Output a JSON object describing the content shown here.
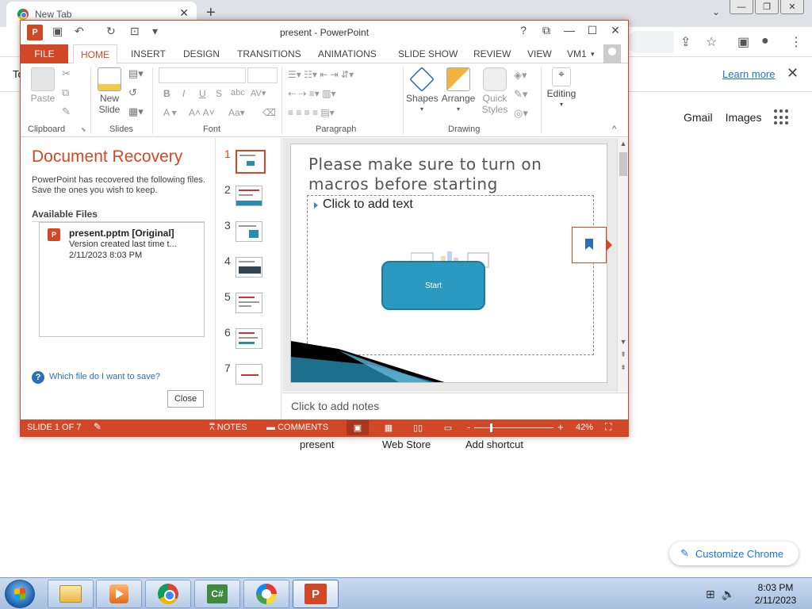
{
  "chrome": {
    "tab_title": "New Tab",
    "tab_close": "✕",
    "new_tab": "+",
    "tab_menu": "⌄",
    "win_minimize": "—",
    "win_restore": "❐",
    "win_close": "✕",
    "infobar_left": "To",
    "learn_more": "Learn more",
    "infobar_close": "✕",
    "gmail": "Gmail",
    "images": "Images",
    "shortcuts": [
      "present",
      "Web Store",
      "Add shortcut"
    ],
    "customize": "Customize Chrome",
    "customize_icon": "✎"
  },
  "powerpoint": {
    "logo": "P",
    "title": "present - PowerPoint",
    "help": "?",
    "ribbon_display": "⧉",
    "minimize": "—",
    "maximize": "☐",
    "close": "✕",
    "qat_save": "💾",
    "qat_undo": "↶",
    "qat_redo": "↻",
    "qat_custom": "▾",
    "tabs": {
      "file": "FILE",
      "home": "HOME",
      "insert": "INSERT",
      "design": "DESIGN",
      "transitions": "TRANSITIONS",
      "animations": "ANIMATIONS",
      "slideshow": "SLIDE SHOW",
      "review": "REVIEW",
      "view": "VIEW",
      "user": "VM1"
    },
    "ribbon": {
      "paste": "Paste",
      "new_slide_1": "New",
      "new_slide_2": "Slide",
      "shapes": "Shapes",
      "arrange": "Arrange",
      "quick_styles_1": "Quick",
      "quick_styles_2": "Styles",
      "editing": "Editing",
      "bold": "B",
      "italic": "I",
      "underline": "U",
      "strike": "S",
      "groups": {
        "clipboard": "Clipboard",
        "slides": "Slides",
        "font": "Font",
        "paragraph": "Paragraph",
        "drawing": "Drawing"
      },
      "collapse": "^"
    },
    "recovery": {
      "title": "Document Recovery",
      "description": "PowerPoint has recovered the following files.  Save the ones you wish to keep.",
      "available_files": "Available Files",
      "file": {
        "icon": "P",
        "name": "present.pptm  [Original]",
        "version": "Version created last time t...",
        "date": "2/11/2023 8:03 PM"
      },
      "help_icon": "?",
      "help_link": "Which file do I want to save?",
      "close": "Close"
    },
    "thumbnails": [
      "1",
      "2",
      "3",
      "4",
      "5",
      "6",
      "7"
    ],
    "slide": {
      "title_line1": "Please make sure to turn on",
      "title_line2": "macros before starting",
      "content_placeholder": "Click to add text",
      "start_button": "Start"
    },
    "notes_placeholder": "Click to add notes",
    "statusbar": {
      "slide_info": "SLIDE 1 OF 7",
      "notes": "NOTES",
      "comments": "COMMENTS",
      "zoom_minus": "-",
      "zoom_plus": "+",
      "zoom": "42%",
      "zoom_fraction": 0.42
    }
  },
  "taskbar": {
    "csharp": "C#",
    "ppt": "P",
    "time": "8:03 PM",
    "date": "2/11/2023"
  }
}
